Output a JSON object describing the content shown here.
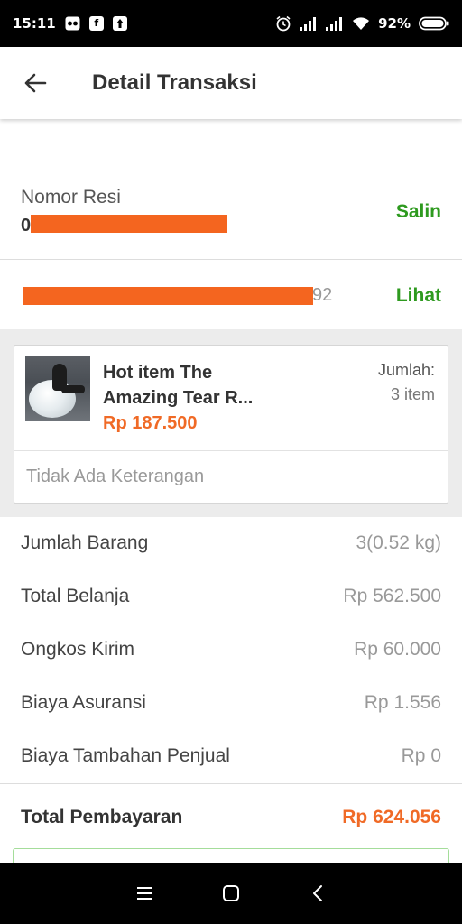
{
  "status_bar": {
    "time": "15:11",
    "battery": "92%"
  },
  "header": {
    "title": "Detail Transaksi"
  },
  "resi": {
    "label": "Nomor Resi",
    "value_visible": "0",
    "action": "Salin"
  },
  "link_row": {
    "value_suffix": "92",
    "action": "Lihat"
  },
  "product": {
    "name": "Hot item The\nAmazing Tear R...",
    "price": "Rp 187.500",
    "qty_label": "Jumlah:",
    "qty_value": "3 item",
    "note": "Tidak Ada Keterangan"
  },
  "summary": [
    {
      "label": "Jumlah Barang",
      "value": "3(0.52 kg)"
    },
    {
      "label": "Total Belanja",
      "value": "Rp 562.500"
    },
    {
      "label": "Ongkos Kirim",
      "value": "Rp 60.000"
    },
    {
      "label": "Biaya Asuransi",
      "value": "Rp 1.556"
    },
    {
      "label": "Biaya Tambahan Penjual",
      "value": "Rp 0"
    }
  ],
  "total": {
    "label": "Total Pembayaran",
    "value": "Rp 624.056"
  },
  "colors": {
    "accent_green": "#2e9a1f",
    "price_orange": "#f06a26",
    "redaction": "#f4651f"
  },
  "icons": {
    "back": "arrow-left-icon",
    "alarm": "alarm-icon",
    "signal": "signal-icon",
    "wifi": "wifi-icon",
    "battery": "battery-icon",
    "nav_menu": "menu-icon",
    "nav_home": "home-square-icon",
    "nav_back": "chevron-left-icon"
  }
}
